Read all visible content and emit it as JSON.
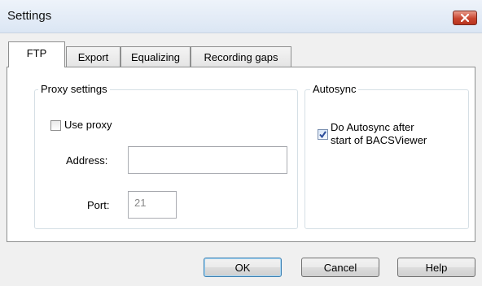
{
  "window": {
    "title": "Settings"
  },
  "tabs": [
    {
      "label": "FTP",
      "active": true
    },
    {
      "label": "Export",
      "active": false
    },
    {
      "label": "Equalizing",
      "active": false
    },
    {
      "label": "Recording gaps",
      "active": false
    }
  ],
  "proxy": {
    "group_label": "Proxy settings",
    "use_proxy_label": "Use proxy",
    "use_proxy_checked": false,
    "address_label": "Address:",
    "address_value": "",
    "port_label": "Port:",
    "port_value": "21"
  },
  "autosync": {
    "group_label": "Autosync",
    "checkbox_label_line1": "Do Autosync after",
    "checkbox_label_line2": "start of BACSViewer",
    "checked": true
  },
  "buttons": {
    "ok": "OK",
    "cancel": "Cancel",
    "help": "Help"
  },
  "icons": {
    "close": "close-icon",
    "check": "checkmark-icon"
  },
  "colors": {
    "close_button": "#c9452f",
    "checkmark": "#2b4c9b",
    "default_button_border": "#3c7fb1"
  }
}
